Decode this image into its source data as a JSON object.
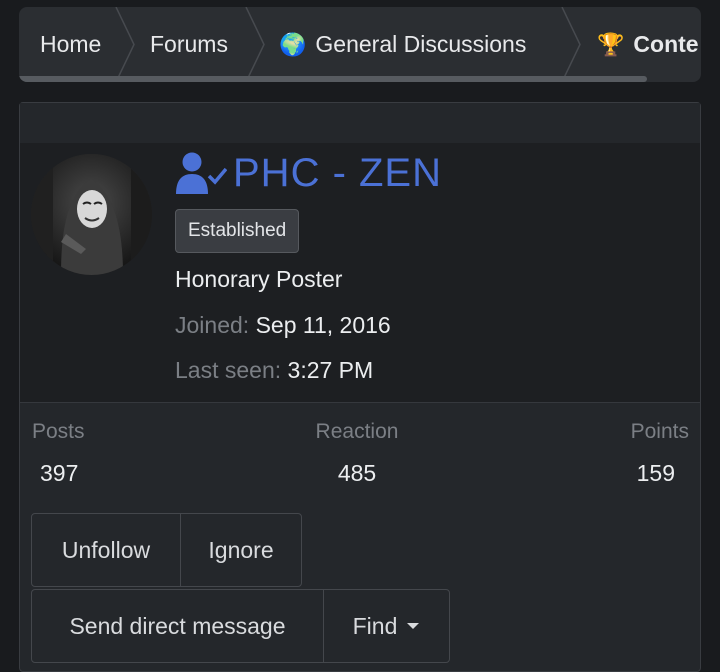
{
  "breadcrumb": {
    "items": [
      {
        "label": "Home"
      },
      {
        "label": "Forums"
      },
      {
        "label": "General Discussions",
        "icon": "globe-icon"
      },
      {
        "label": "Conte",
        "icon": "trophy-icon"
      }
    ]
  },
  "profile": {
    "name": "PHC - ZEN",
    "badge": "Established",
    "user_title": "Honorary Poster",
    "joined_label": "Joined:",
    "joined_value": "Sep 11, 2016",
    "last_seen_label": "Last seen:",
    "last_seen_value": "3:27 PM",
    "name_color": "#4b71d6"
  },
  "stats": {
    "posts_label": "Posts",
    "posts_value": "397",
    "reaction_label": "Reaction",
    "reaction_value": "485",
    "points_label": "Points",
    "points_value": "159"
  },
  "actions": {
    "unfollow": "Unfollow",
    "ignore": "Ignore",
    "send_message": "Send direct message",
    "find": "Find"
  }
}
